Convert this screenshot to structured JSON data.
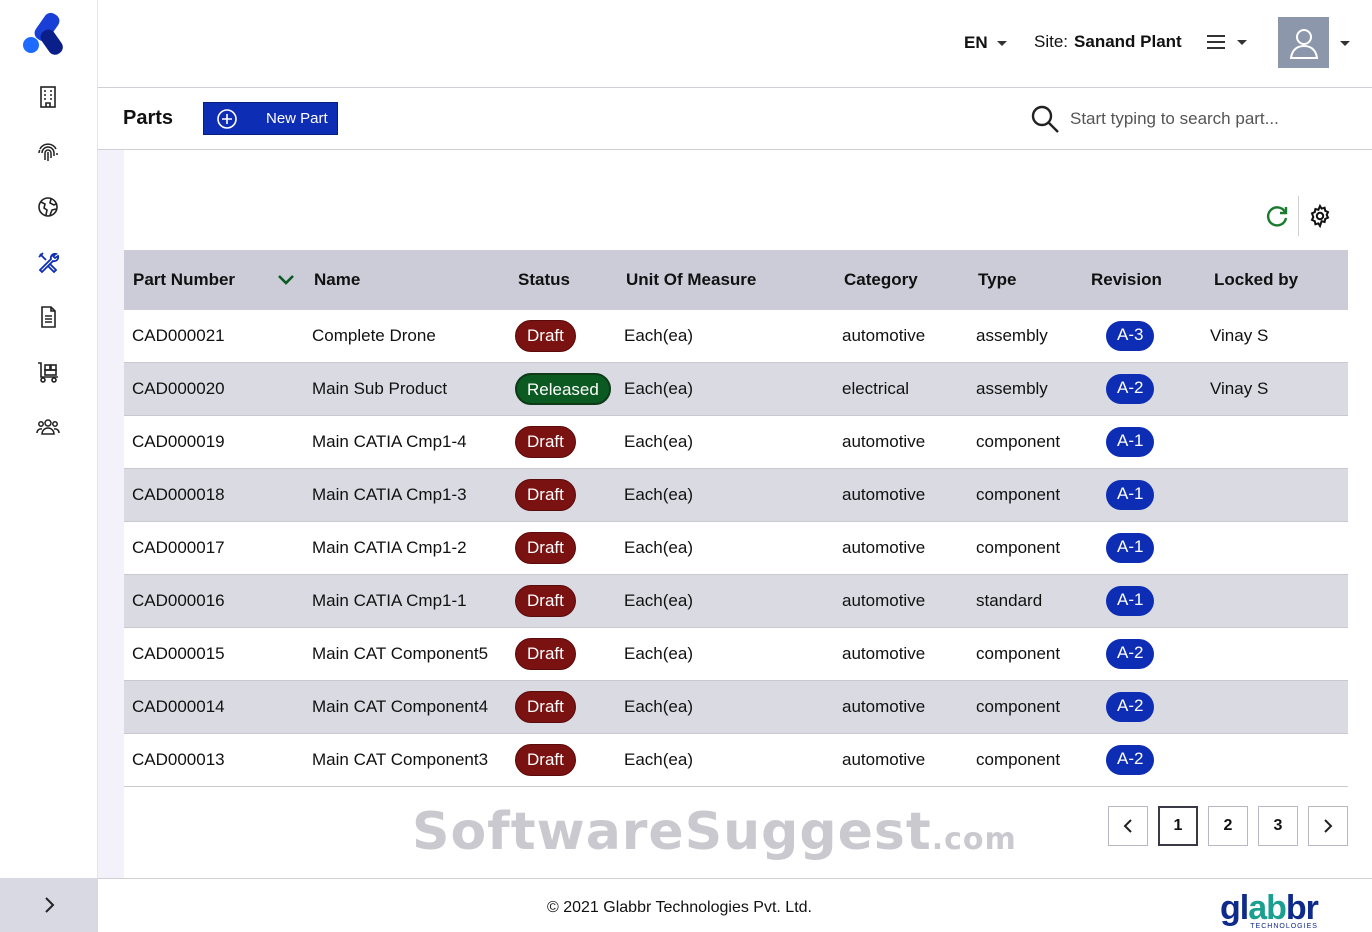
{
  "header": {
    "language": "EN",
    "site_label": "Site:",
    "site_value": "Sanand Plant"
  },
  "toolbar": {
    "page_title": "Parts",
    "new_part_label": "New Part",
    "search_placeholder": "Start typing to search part..."
  },
  "table": {
    "columns": [
      "Part Number",
      "Name",
      "Status",
      "Unit Of Measure",
      "Category",
      "Type",
      "Revision",
      "Locked by"
    ],
    "rows": [
      {
        "part_number": "CAD000021",
        "name": "Complete Drone",
        "status": "Draft",
        "uom": "Each(ea)",
        "category": "automotive",
        "type": "assembly",
        "revision": "A-3",
        "locked_by": "Vinay S"
      },
      {
        "part_number": "CAD000020",
        "name": "Main Sub Product",
        "status": "Released",
        "uom": "Each(ea)",
        "category": "electrical",
        "type": "assembly",
        "revision": "A-2",
        "locked_by": "Vinay S"
      },
      {
        "part_number": "CAD000019",
        "name": "Main CATIA Cmp1-4",
        "status": "Draft",
        "uom": "Each(ea)",
        "category": "automotive",
        "type": "component",
        "revision": "A-1",
        "locked_by": ""
      },
      {
        "part_number": "CAD000018",
        "name": "Main CATIA Cmp1-3",
        "status": "Draft",
        "uom": "Each(ea)",
        "category": "automotive",
        "type": "component",
        "revision": "A-1",
        "locked_by": ""
      },
      {
        "part_number": "CAD000017",
        "name": "Main CATIA Cmp1-2",
        "status": "Draft",
        "uom": "Each(ea)",
        "category": "automotive",
        "type": "component",
        "revision": "A-1",
        "locked_by": ""
      },
      {
        "part_number": "CAD000016",
        "name": "Main CATIA Cmp1-1",
        "status": "Draft",
        "uom": "Each(ea)",
        "category": "automotive",
        "type": "standard",
        "revision": "A-1",
        "locked_by": ""
      },
      {
        "part_number": "CAD000015",
        "name": "Main CAT Component5",
        "status": "Draft",
        "uom": "Each(ea)",
        "category": "automotive",
        "type": "component",
        "revision": "A-2",
        "locked_by": ""
      },
      {
        "part_number": "CAD000014",
        "name": "Main CAT Component4",
        "status": "Draft",
        "uom": "Each(ea)",
        "category": "automotive",
        "type": "component",
        "revision": "A-2",
        "locked_by": ""
      },
      {
        "part_number": "CAD000013",
        "name": "Main CAT Component3",
        "status": "Draft",
        "uom": "Each(ea)",
        "category": "automotive",
        "type": "component",
        "revision": "A-2",
        "locked_by": ""
      }
    ]
  },
  "pagination": {
    "prev": "<",
    "pages": [
      "1",
      "2",
      "3"
    ],
    "current": "1",
    "next": ">"
  },
  "watermark": {
    "main": "SoftwareSuggest",
    "suffix": ".com"
  },
  "footer": {
    "copyright": "© 2021 Glabbr Technologies Pvt. Ltd.",
    "brand_prefix": "gl",
    "brand_mid": "ab",
    "brand_suffix": "br",
    "brand_sub": "TECHNOLOGIES"
  },
  "sidebar": {
    "icons": [
      "building-icon",
      "fingerprint-icon",
      "globe-icon",
      "tools-icon",
      "document-icon",
      "forklift-icon",
      "users-icon"
    ]
  },
  "colors": {
    "primary": "#0d2db4",
    "draft": "#7a1212",
    "released": "#0b5a22",
    "table_header": "#ccccd9",
    "row_alt": "#dadae3",
    "refresh": "#1a7a2e",
    "active_nav": "#0d2db4"
  }
}
